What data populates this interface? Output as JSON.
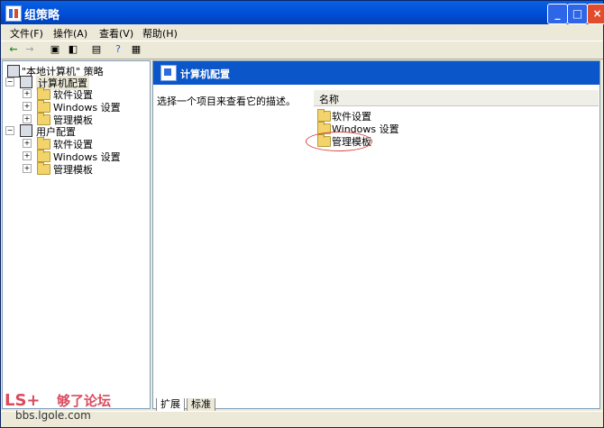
{
  "window": {
    "title": "组策略"
  },
  "menu": [
    "文件(F)",
    "操作(A)",
    "查看(V)",
    "帮助(H)"
  ],
  "toolbar": {
    "icons": [
      "back-icon",
      "forward-icon",
      "up-folder-icon",
      "show-hide-tree-icon",
      "export-list-icon",
      "help-icon",
      "properties-icon"
    ]
  },
  "tree": {
    "root": "\"本地计算机\" 策略",
    "computer": {
      "label": "计算机配置",
      "children": [
        "软件设置",
        "Windows 设置",
        "管理模板"
      ]
    },
    "user": {
      "label": "用户配置",
      "children": [
        "软件设置",
        "Windows 设置",
        "管理模板"
      ]
    }
  },
  "detail": {
    "header": "计算机配置",
    "description": "选择一个项目来查看它的描述。",
    "column": "名称",
    "items": [
      "软件设置",
      "Windows 设置",
      "管理模板"
    ]
  },
  "tabs": [
    "扩展",
    "标准"
  ],
  "watermark": {
    "logo": "LS+",
    "brand": "够了论坛",
    "url": "bbs.lgole.com"
  }
}
